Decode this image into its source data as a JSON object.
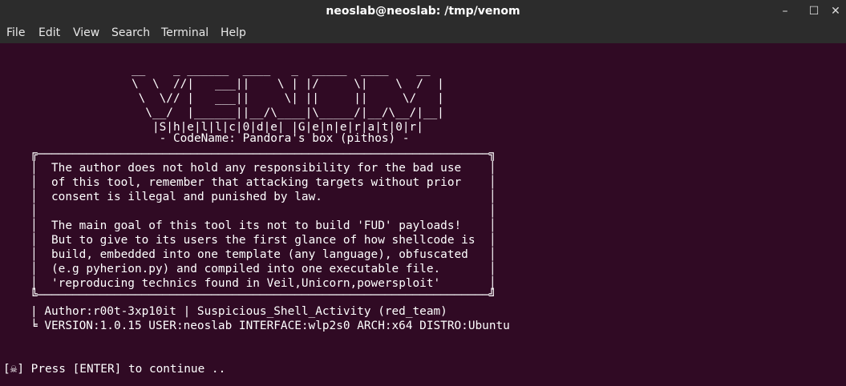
{
  "window": {
    "title": "neoslab@neoslab: /tmp/venom",
    "controls": {
      "minimize": "–",
      "maximize": "☐",
      "close": "✕"
    }
  },
  "menu": {
    "file": "File",
    "edit": "Edit",
    "view": "View",
    "search": "Search",
    "terminal": "Terminal",
    "help": "Help"
  },
  "terminal": {
    "banner": [
      "         __    _ ______  ____   _  _____  ____    __",
      "         \\  \\  //|   ___||    \\ | |/     \\|    \\  /  |",
      "          \\  \\// |   ___||     \\| ||     ||     \\/   |",
      "           \\__/  |______||__/\\____|\\_____/|__/\\__/|__|",
      "            |S|h|e|l|l|c|0|d|e| |G|e|n|e|r|a|t|0|r|",
      "             - CodeName: Pandora's box (pithos) -"
    ],
    "disclaimer": {
      "top": "╔─────────────────────────────────────────────────────────────────╗",
      "bottom": "╚─────────────────────────────────────────────────────────────────╝",
      "lines": [
        "  The author does not hold any responsibility for the bad use    ",
        "  of this tool, remember that attacking targets without prior    ",
        "  consent is illegal and punished by law.                        ",
        "                                                                 ",
        "  The main goal of this tool its not to build 'FUD' payloads!    ",
        "  But to give to its users the first glance of how shellcode is  ",
        "  build, embedded into one template (any language), obfuscated   ",
        "  (e.g pyherion.py) and compiled into one executable file.       ",
        "  'reproducing technics found in Veil,Unicorn,powersploit'       "
      ]
    },
    "author_line": "| Author:r00t-3xp10it | Suspicious_Shell_Activity (red_team)",
    "version_line": "╘ VERSION:1.0.15 USER:neoslab INTERFACE:wlp2s0 ARCH:x64 DISTRO:Ubuntu",
    "prompt_line": "[☠] Press [ENTER] to continue .."
  }
}
